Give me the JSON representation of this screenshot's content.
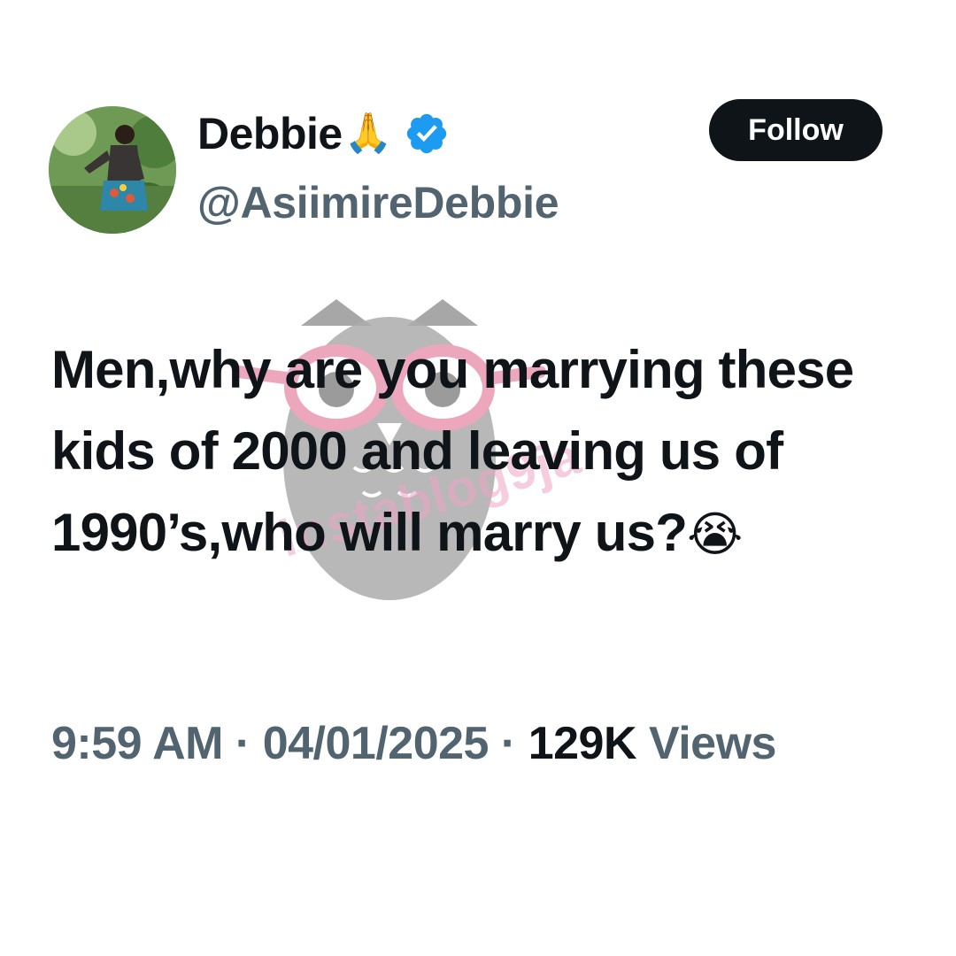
{
  "author": {
    "display_name": "Debbie",
    "name_emoji": "🙏",
    "verified_icon": "verified-badge-icon",
    "handle": "@AsiimireDebbie",
    "avatar_icon": "profile-photo"
  },
  "follow_button": {
    "label": "Follow"
  },
  "tweet": {
    "text": "Men,why are you marrying these kids of 2000 and leaving us of 1990’s,who will marry us?",
    "trailing_emoji": "😭"
  },
  "meta": {
    "time": "9:59 AM",
    "separator": "·",
    "date": "04/01/2025",
    "views_count": "129K",
    "views_label": "Views"
  },
  "watermark": {
    "text": "instablog9ja"
  },
  "colors": {
    "text_primary": "#0f1419",
    "text_secondary": "#536471",
    "verified_blue": "#1d9bf0",
    "follow_bg": "#0f1419",
    "background": "#ffffff"
  }
}
